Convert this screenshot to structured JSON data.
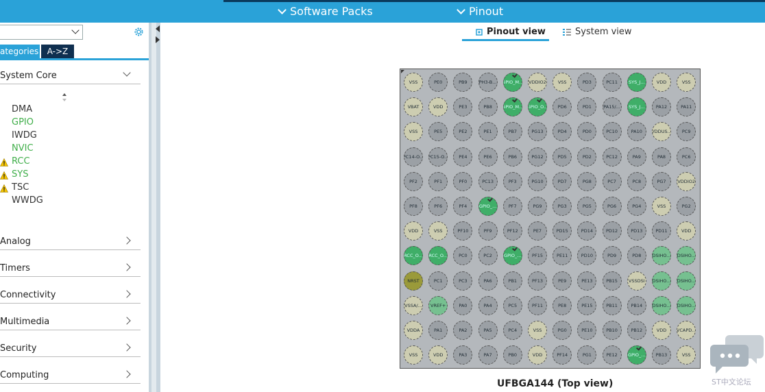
{
  "top_menu": {
    "software_packs": "Software Packs",
    "pinout": "Pinout"
  },
  "sidebar": {
    "tab_categories": "ategories",
    "tab_az": "A->Z",
    "system_core": "System Core",
    "items": [
      {
        "label": "DMA",
        "status": "normal"
      },
      {
        "label": "GPIO",
        "status": "ok"
      },
      {
        "label": "IWDG",
        "status": "normal"
      },
      {
        "label": "NVIC",
        "status": "ok"
      },
      {
        "label": "RCC",
        "status": "warn-ok"
      },
      {
        "label": "SYS",
        "status": "warn-ok"
      },
      {
        "label": "TSC",
        "status": "warn"
      },
      {
        "label": "WWDG",
        "status": "normal"
      }
    ],
    "categories": [
      "Analog",
      "Timers",
      "Connectivity",
      "Multimedia",
      "Security",
      "Computing"
    ]
  },
  "views": {
    "pinout": "Pinout view",
    "system": "System view"
  },
  "package_label": "UFBGA144 (Top view)",
  "watermark": "ST中文论坛",
  "colors": {
    "accent": "#2aa2d8",
    "dark": "#0f2f4f",
    "pin_gray": "#9ba0a5",
    "pin_power": "#cdcdb1",
    "pin_green": "#3fae68",
    "pin_light": "#76c090",
    "pin_reset": "#9a9a3a",
    "ok_green": "#3fae49"
  },
  "pins": [
    [
      "VSS",
      "PE0",
      "PB9",
      "PH3-B...",
      "GPIO_M...",
      "VDDIO2",
      "VSS",
      "PD3",
      "PC11",
      "SYS_J...",
      "VDD",
      "VSS"
    ],
    [
      "VBAT",
      "VDD",
      "PE3",
      "PB8",
      "GPIO_M...",
      "GPIO_O...",
      "PD6",
      "PD1",
      "PA15/...",
      "SYS_J...",
      "PA12",
      "PA11"
    ],
    [
      "VSS",
      "PE5",
      "PE2",
      "PE1",
      "PB7",
      "PG13",
      "PD4",
      "PD0",
      "PC10",
      "PA10",
      "VDDUS...",
      "PC9"
    ],
    [
      "PC14-O...",
      "PC15-O...",
      "PE4",
      "PE6",
      "PB6",
      "PG12",
      "PD5",
      "PD2",
      "PC12",
      "PA9",
      "PA8",
      "PC6"
    ],
    [
      "PF2",
      "PF1",
      "PF0",
      "PC13",
      "PF3",
      "PG10",
      "PD7",
      "PG8",
      "PC7",
      "PC8",
      "PG7",
      "VDDIO2"
    ],
    [
      "PF8",
      "PF6",
      "PF4",
      "GPIO_...",
      "PF7",
      "PG9",
      "PG3",
      "PG5",
      "PG6",
      "PG4",
      "VSS",
      "PG2"
    ],
    [
      "VDD",
      "VSS",
      "PF10",
      "PF9",
      "PF12",
      "PE7",
      "PD15",
      "PD14",
      "PD12",
      "PD13",
      "PD11",
      "VDD"
    ],
    [
      "RCC_O...",
      "RCC_O...",
      "PC0",
      "PC2",
      "GPIO_...",
      "PF15",
      "PE11",
      "PD10",
      "PD9",
      "PD8",
      "DSIHO...",
      "DSIHO..."
    ],
    [
      "NRST",
      "PC1",
      "PC3",
      "PA6",
      "PB1",
      "PF13",
      "PE9",
      "PE13",
      "PB15",
      "VSSDSI",
      "DSIHO...",
      "DSIHO..."
    ],
    [
      "VSSA/...",
      "VREF+",
      "PA0",
      "PA4",
      "PC5",
      "PF11",
      "PE8",
      "PE15",
      "PB11",
      "PB14",
      "DSIHO...",
      "DSIHO..."
    ],
    [
      "VDDA",
      "PA1",
      "PA2",
      "PA5",
      "PC4",
      "VSS",
      "PG0",
      "PE10",
      "PB10",
      "PB12",
      "VDD",
      "VCAPD..."
    ],
    [
      "VSS",
      "VDD",
      "PA3",
      "PA7",
      "PB0",
      "VDD",
      "PF14",
      "PG1",
      "PE12",
      "GPIO_...",
      "PB13",
      "VSS"
    ]
  ],
  "pin_types": [
    [
      "pw",
      "n",
      "n",
      "n",
      "gc",
      "pw",
      "pw",
      "n",
      "n",
      "g",
      "pw",
      "pw"
    ],
    [
      "pw",
      "pw",
      "n",
      "n",
      "gc",
      "gc",
      "n",
      "n",
      "n",
      "g",
      "n",
      "n"
    ],
    [
      "pw",
      "n",
      "n",
      "n",
      "n",
      "n",
      "n",
      "n",
      "n",
      "n",
      "pw",
      "n"
    ],
    [
      "n",
      "n",
      "n",
      "n",
      "n",
      "n",
      "n",
      "n",
      "n",
      "n",
      "n",
      "n"
    ],
    [
      "n",
      "n",
      "n",
      "n",
      "n",
      "n",
      "n",
      "n",
      "n",
      "n",
      "n",
      "pw"
    ],
    [
      "n",
      "n",
      "n",
      "gc",
      "n",
      "n",
      "n",
      "n",
      "n",
      "n",
      "pw",
      "n"
    ],
    [
      "pw",
      "pw",
      "n",
      "n",
      "n",
      "n",
      "n",
      "n",
      "n",
      "n",
      "n",
      "pw"
    ],
    [
      "g",
      "g",
      "n",
      "n",
      "gc",
      "n",
      "n",
      "n",
      "n",
      "n",
      "lg",
      "lg"
    ],
    [
      "y",
      "n",
      "n",
      "n",
      "n",
      "n",
      "n",
      "n",
      "n",
      "pw",
      "lg",
      "lg"
    ],
    [
      "pw",
      "lg",
      "n",
      "n",
      "n",
      "n",
      "n",
      "n",
      "n",
      "n",
      "lg",
      "lg"
    ],
    [
      "pw",
      "n",
      "n",
      "n",
      "n",
      "pw",
      "n",
      "n",
      "n",
      "n",
      "pw",
      "pw"
    ],
    [
      "pw",
      "pw",
      "n",
      "n",
      "n",
      "pw",
      "n",
      "n",
      "n",
      "gc",
      "n",
      "pw"
    ]
  ]
}
